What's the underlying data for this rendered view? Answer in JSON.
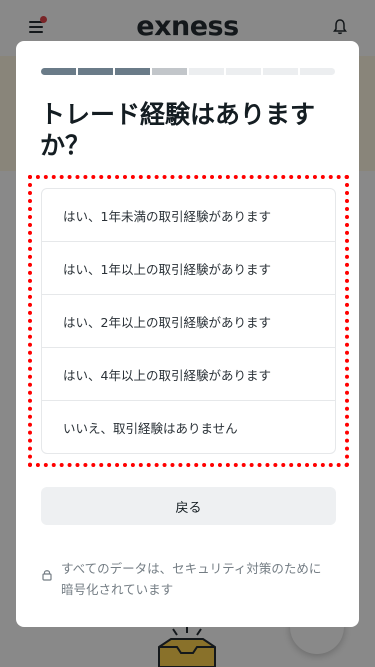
{
  "app": {
    "logo_text": "exness",
    "accent_color": "#e0373c",
    "icons": [
      "menu-icon",
      "notification-dot",
      "bell-icon"
    ]
  },
  "modal": {
    "progress": {
      "total_steps": 8,
      "completed_steps": 3,
      "current_step": 4,
      "completed_color": "#6a7b88",
      "current_color": "#c2c6ca",
      "pending_color": "#eceef0"
    },
    "title": "トレード経験はありますか？",
    "options": [
      {
        "label": "はい、1年未満の取引経験があります"
      },
      {
        "label": "はい、1年以上の取引経験があります"
      },
      {
        "label": "はい、2年以上の取引経験があります"
      },
      {
        "label": "はい、4年以上の取引経験があります"
      },
      {
        "label": "いいえ、取引経験はありません"
      }
    ],
    "back_label": "戻る",
    "security_note": "すべてのデータは、セキュリティ対策のために暗号化されています",
    "security_icon": "lock-icon",
    "highlight_color": "#ff0000"
  }
}
